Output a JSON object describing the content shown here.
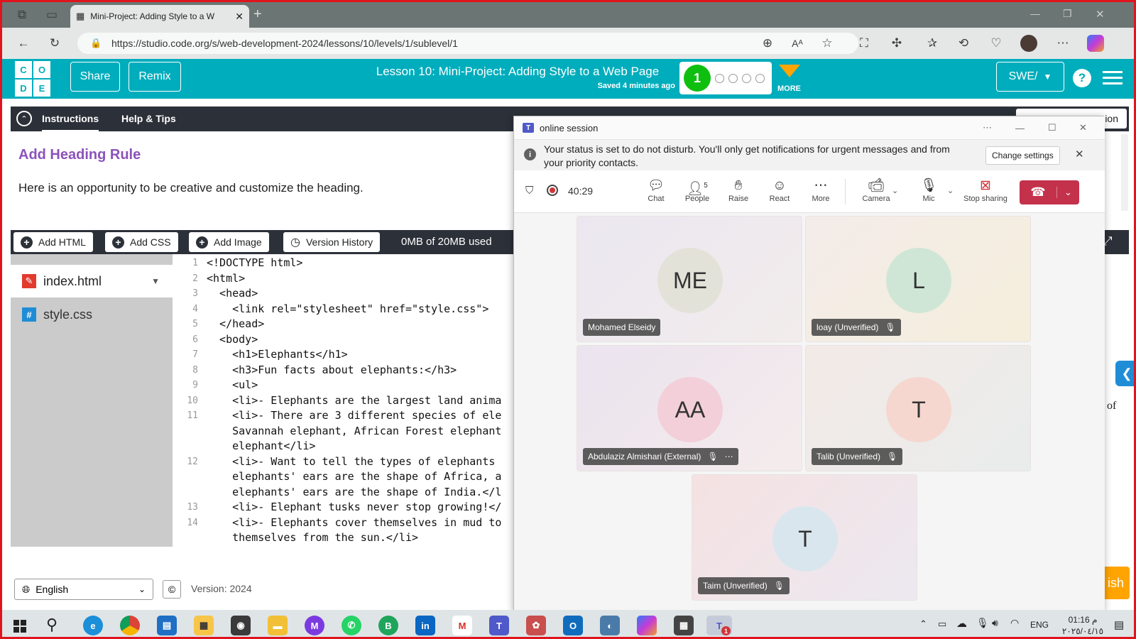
{
  "browser": {
    "tab_title": "Mini-Project: Adding Style to a W",
    "new_tab": "+",
    "url": "https://studio.code.org/s/web-development-2024/lessons/10/levels/1/sublevel/1"
  },
  "header": {
    "logo_letters": [
      "C",
      "O",
      "D",
      "E"
    ],
    "share_label": "Share",
    "remix_label": "Remix",
    "lesson_title": "Lesson 10: Mini-Project: Adding Style to a Web Page",
    "saved_text": "Saved 4 minutes ago",
    "progress_current": "1",
    "more_label": "MORE",
    "section_label": "SWE/",
    "help_label": "?"
  },
  "instructions": {
    "tab_instructions": "Instructions",
    "tab_help": "Help & Tips",
    "heading": "Add Heading Rule",
    "body": "Here is an opportunity to be creative and customize the heading.",
    "right_cut_text": "ion"
  },
  "toolbar": {
    "add_html": "Add HTML",
    "add_css": "Add CSS",
    "add_image": "Add Image",
    "version_history": "Version History",
    "storage": "0MB of 20MB used"
  },
  "files": {
    "items": [
      {
        "name": "index.html",
        "icon": "pencil-icon"
      },
      {
        "name": "style.css",
        "icon": "hash-icon"
      }
    ]
  },
  "code": {
    "lines": [
      {
        "n": "1",
        "text": "<!DOCTYPE html>"
      },
      {
        "n": "2",
        "text": "<html>"
      },
      {
        "n": "3",
        "text": "  <head>"
      },
      {
        "n": "4",
        "text": "    <link rel=\"stylesheet\" href=\"style.css\">"
      },
      {
        "n": "5",
        "text": "  </head>"
      },
      {
        "n": "6",
        "text": "  <body>"
      },
      {
        "n": "7",
        "text": "    <h1>Elephants</h1>"
      },
      {
        "n": "8",
        "text": "    <h3>Fun facts about elephants:</h3>"
      },
      {
        "n": "9",
        "text": "    <ul>"
      },
      {
        "n": "10",
        "text": "    <li>- Elephants are the largest land anima"
      },
      {
        "n": "11",
        "text": "    <li>- There are 3 different species of ele"
      },
      {
        "n": "",
        "text": "    Savannah elephant, African Forest elephant"
      },
      {
        "n": "",
        "text": "    elephant</li>"
      },
      {
        "n": "12",
        "text": "    <li>- Want to tell the types of elephants"
      },
      {
        "n": "",
        "text": "    elephants' ears are the shape of Africa, a"
      },
      {
        "n": "",
        "text": "    elephants' ears are the shape of India.</l"
      },
      {
        "n": "13",
        "text": "    <li>- Elephant tusks never stop growing!</"
      },
      {
        "n": "14",
        "text": "    <li>- Elephants cover themselves in mud to"
      },
      {
        "n": "",
        "text": "    themselves from the sun.</li>"
      }
    ]
  },
  "footer": {
    "language": "English",
    "version": "Version: 2024",
    "finish_partial": "ish",
    "right_text": "of"
  },
  "teams": {
    "window_title": "online session",
    "banner_text": "Your status is set to do not disturb. You'll only get notifications for urgent messages and from your priority contacts.",
    "change_settings": "Change settings",
    "timer": "40:29",
    "controls": {
      "chat": "Chat",
      "people": "People",
      "people_count": "5",
      "raise": "Raise",
      "react": "React",
      "more": "More",
      "camera": "Camera",
      "mic": "Mic",
      "stop_sharing": "Stop sharing"
    },
    "participants": [
      {
        "initials": "ME",
        "name": "Mohamed Elseidy"
      },
      {
        "initials": "L",
        "name": "loay (Unverified)"
      },
      {
        "initials": "AA",
        "name": "Abdulaziz Almishari (External)"
      },
      {
        "initials": "T",
        "name": "Talib (Unverified)"
      },
      {
        "initials": "T",
        "name": "Taim (Unverified)"
      }
    ]
  },
  "taskbar": {
    "lang": "ENG",
    "time": "01:16 م",
    "date": "٢٠٢٥/٠٤/١٥",
    "notification_badge": "1"
  }
}
